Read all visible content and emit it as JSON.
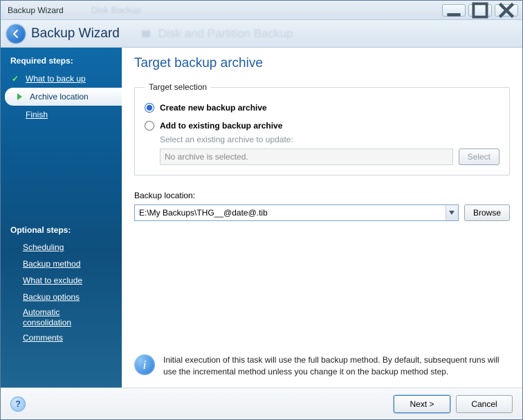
{
  "window": {
    "title": "Backup Wizard",
    "faded_hint": "Disk Backup"
  },
  "header": {
    "title": "Backup Wizard",
    "faded_hint": "Disk and Partition Backup"
  },
  "sidebar": {
    "required_heading": "Required steps:",
    "optional_heading": "Optional steps:",
    "steps": {
      "what_to_back_up": "What to back up",
      "archive_location": "Archive location",
      "finish": "Finish"
    },
    "optional": {
      "scheduling": "Scheduling",
      "backup_method": "Backup method",
      "what_to_exclude": "What to exclude",
      "backup_options": "Backup options",
      "automatic_consolidation": "Automatic consolidation",
      "comments": "Comments"
    }
  },
  "main": {
    "heading": "Target backup archive",
    "target_selection_legend": "Target selection",
    "radio_create": "Create new backup archive",
    "radio_add": "Add to existing backup archive",
    "select_hint": "Select an existing archive to update:",
    "no_archive_text": "No archive is selected.",
    "select_button": "Select",
    "backup_location_label": "Backup location:",
    "backup_location_value": "E:\\My Backups\\THG__@date@.tib",
    "browse_button": "Browse",
    "info_text": "Initial execution of this task will use the full backup method. By default, subsequent runs will use the incremental method unless you change it on the backup method step."
  },
  "footer": {
    "next": "Next >",
    "cancel": "Cancel"
  }
}
